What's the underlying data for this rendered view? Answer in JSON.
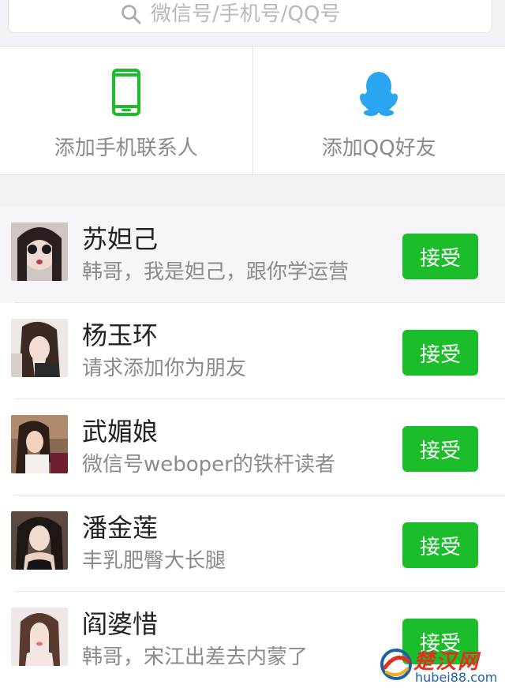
{
  "search": {
    "placeholder": "微信号/手机号/QQ号",
    "icon": "search-icon"
  },
  "add_options": [
    {
      "label": "添加手机联系人",
      "icon": "phone-icon",
      "color": "#1cbd2b"
    },
    {
      "label": "添加QQ好友",
      "icon": "qq-penguin-icon",
      "color": "#2aa5f0"
    }
  ],
  "requests": [
    {
      "name": "苏妲己",
      "message": "韩哥，我是妲己，跟你学运营",
      "button": "接受"
    },
    {
      "name": "杨玉环",
      "message": "请求添加你为朋友",
      "button": "接受"
    },
    {
      "name": "武媚娘",
      "message": "微信号weboper的铁杆读者",
      "button": "接受"
    },
    {
      "name": "潘金莲",
      "message": "丰乳肥臀大长腿",
      "button": "接受"
    },
    {
      "name": "阎婆惜",
      "message": "韩哥，宋江出差去内蒙了",
      "button": "接受"
    }
  ],
  "watermark": {
    "cn": "楚汉网",
    "url": "hubei88.com"
  },
  "colors": {
    "accent_green": "#1cbd2b",
    "qq_blue": "#2aa5f0",
    "background": "#f2f1f6"
  }
}
